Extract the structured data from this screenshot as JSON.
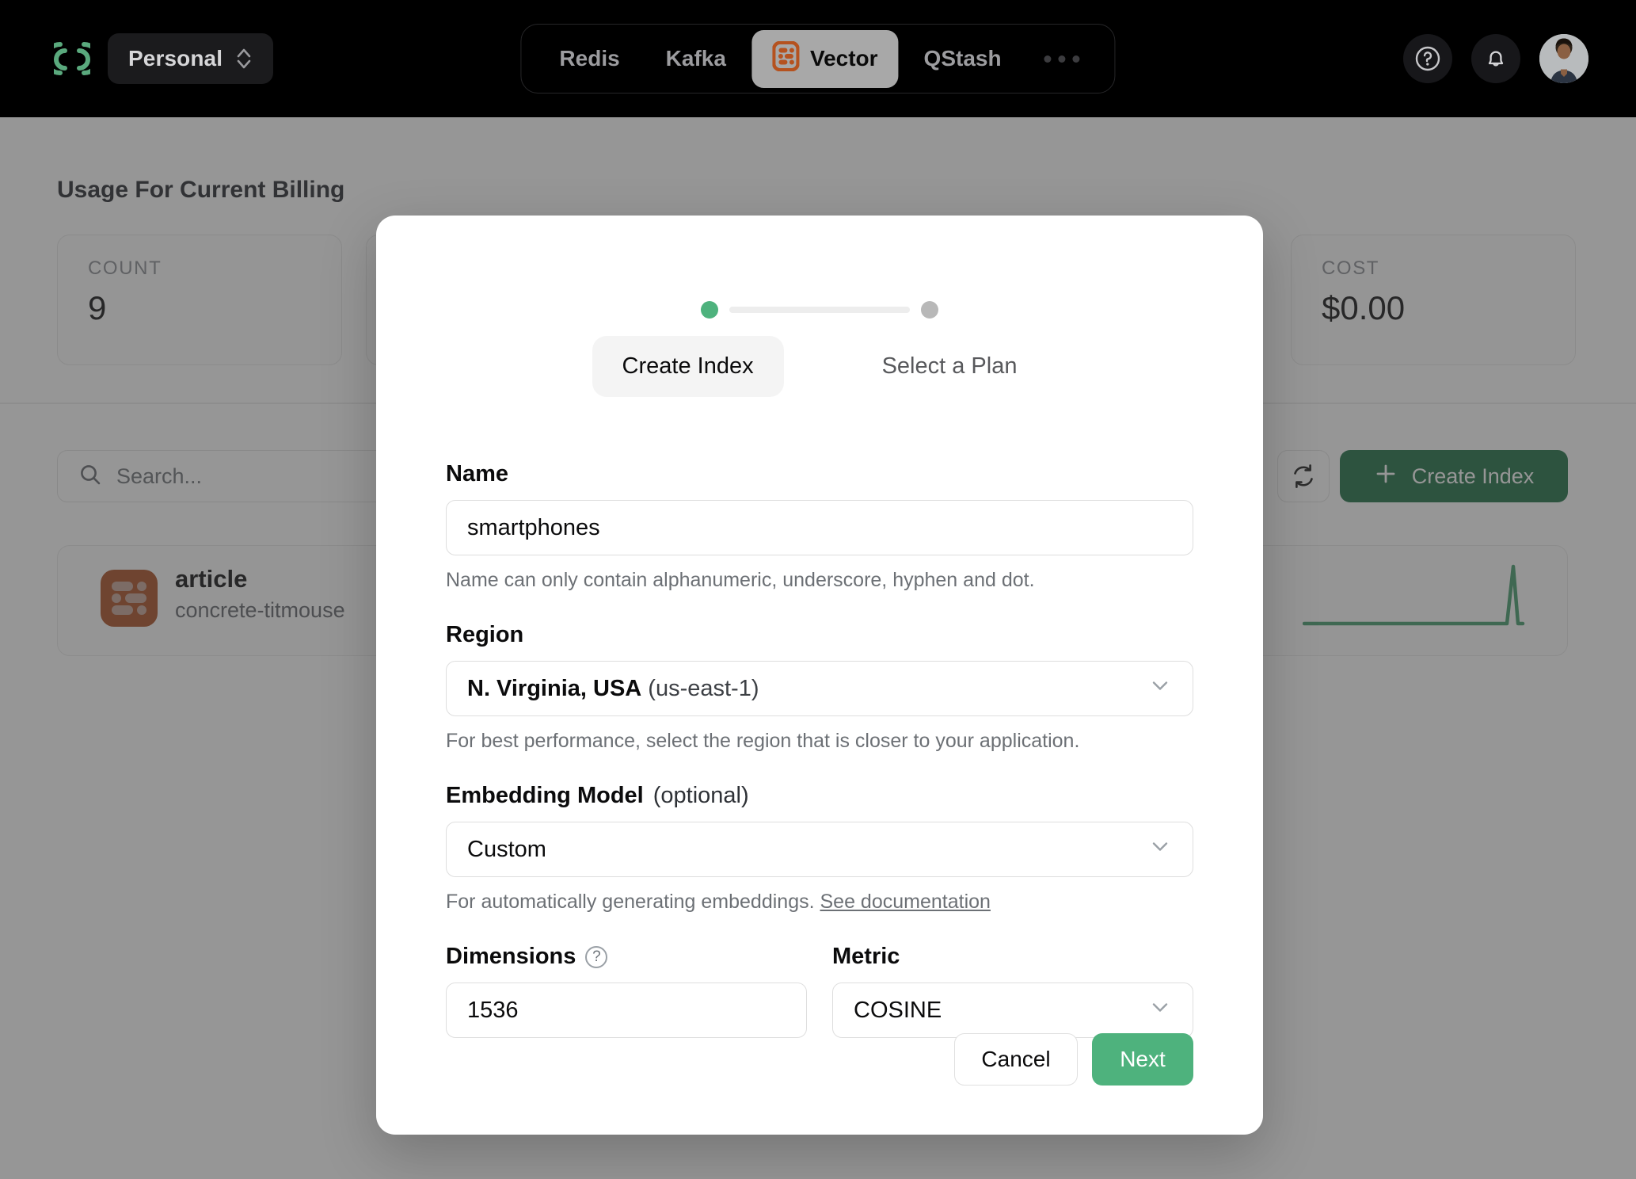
{
  "topnav": {
    "logo_icon": "upstash-logo-icon",
    "org_switcher": {
      "label": "Personal",
      "icon": "chevron-updown-icon"
    },
    "tabs": [
      {
        "label": "Redis",
        "active": false
      },
      {
        "label": "Kafka",
        "active": false
      },
      {
        "label": "Vector",
        "active": true,
        "icon": "vector-index-icon"
      },
      {
        "label": "QStash",
        "active": false
      }
    ],
    "overflow_icon": "ellipsis-icon",
    "help_icon": "help-circle-icon",
    "notifications_icon": "bell-icon",
    "avatar_icon": "user-avatar"
  },
  "page": {
    "usage_title": "Usage For Current Billing",
    "stats": [
      {
        "label": "COUNT",
        "value": "9"
      },
      {
        "label": "",
        "value": ""
      },
      {
        "label": "COST",
        "value": "$0.00"
      }
    ],
    "search": {
      "placeholder": "Search...",
      "icon": "search-icon",
      "value": ""
    },
    "refresh_icon": "refresh-icon",
    "create_button": {
      "label": "Create Index",
      "icon": "plus-icon",
      "color": "#186a3e"
    },
    "index_row": {
      "icon": "vector-index-icon",
      "name": "article",
      "endpoint": "concrete-titmouse",
      "sparkline_color": "#3f9a68"
    }
  },
  "modal": {
    "steps": [
      {
        "label": "Create Index",
        "state": "active",
        "dot_color": "#4eb27d"
      },
      {
        "label": "Select a Plan",
        "state": "upcoming",
        "dot_color": "#b8b8b8"
      }
    ],
    "name_field": {
      "label": "Name",
      "value": "smartphones",
      "placeholder": "",
      "hint": "Name can only contain alphanumeric, underscore, hyphen and dot."
    },
    "region_field": {
      "label": "Region",
      "value_strong": "N. Virginia, USA",
      "value_light": "(us-east-1)",
      "hint": "For best performance, select the region that is closer to your application.",
      "chevron_icon": "chevron-down-icon"
    },
    "embedding_field": {
      "label": "Embedding Model",
      "label_optional": "(optional)",
      "value": "Custom",
      "hint_text": "For automatically generating embeddings.",
      "hint_link": "See documentation",
      "chevron_icon": "chevron-down-icon"
    },
    "dimensions_field": {
      "label": "Dimensions",
      "help_icon": "help-circle-icon",
      "value": "1536"
    },
    "metric_field": {
      "label": "Metric",
      "value": "COSINE",
      "chevron_icon": "chevron-down-icon"
    },
    "cancel_label": "Cancel",
    "next_label": "Next",
    "next_color": "#4eb27d"
  }
}
